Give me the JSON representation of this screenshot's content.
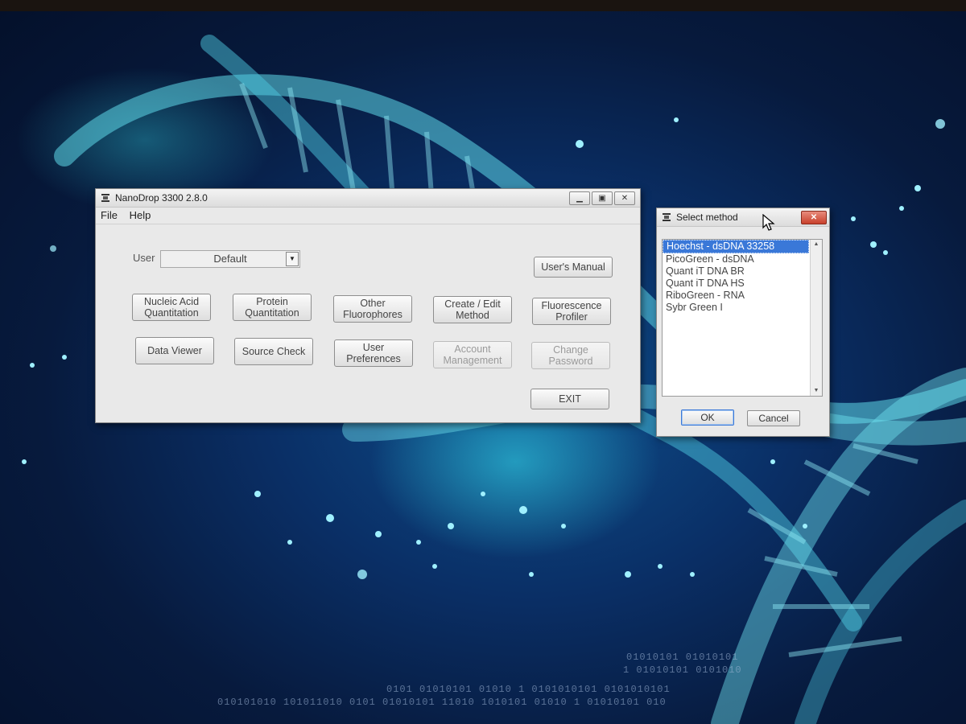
{
  "main_window": {
    "title": "NanoDrop 3300  2.8.0",
    "menu": [
      "File",
      "Help"
    ],
    "user_label": "User",
    "user_value": "Default",
    "buttons": {
      "users_manual": "User's Manual",
      "nucleic_acid": "Nucleic Acid Quantitation",
      "protein": "Protein Quantitation",
      "other_fluorophores": "Other Fluorophores",
      "create_edit_method": "Create / Edit Method",
      "fluorescence_profiler": "Fluorescence Profiler",
      "data_viewer": "Data Viewer",
      "source_check": "Source Check",
      "user_preferences": "User Preferences",
      "account_management": "Account Management",
      "change_password": "Change Password",
      "exit": "EXIT"
    }
  },
  "select_dialog": {
    "title": "Select method",
    "methods": [
      "Hoechst - dsDNA 33258",
      "PicoGreen - dsDNA",
      "Quant iT DNA BR",
      "Quant iT DNA HS",
      "RiboGreen - RNA",
      "Sybr Green I"
    ],
    "selected_index": 0,
    "ok_label": "OK",
    "cancel_label": "Cancel"
  },
  "desktop": {
    "binary_lines": [
      "01010101  01010101",
      "1 01010101  0101010",
      "0101 01010101 01010 1 0101010101 0101010101",
      "010101010 101011010 0101 01010101 11010 1010101 01010  1 01010101 010"
    ]
  },
  "colors": {
    "selection": "#3a78d8",
    "close_button": "#c8412c",
    "helix": "#4fd6e8"
  }
}
